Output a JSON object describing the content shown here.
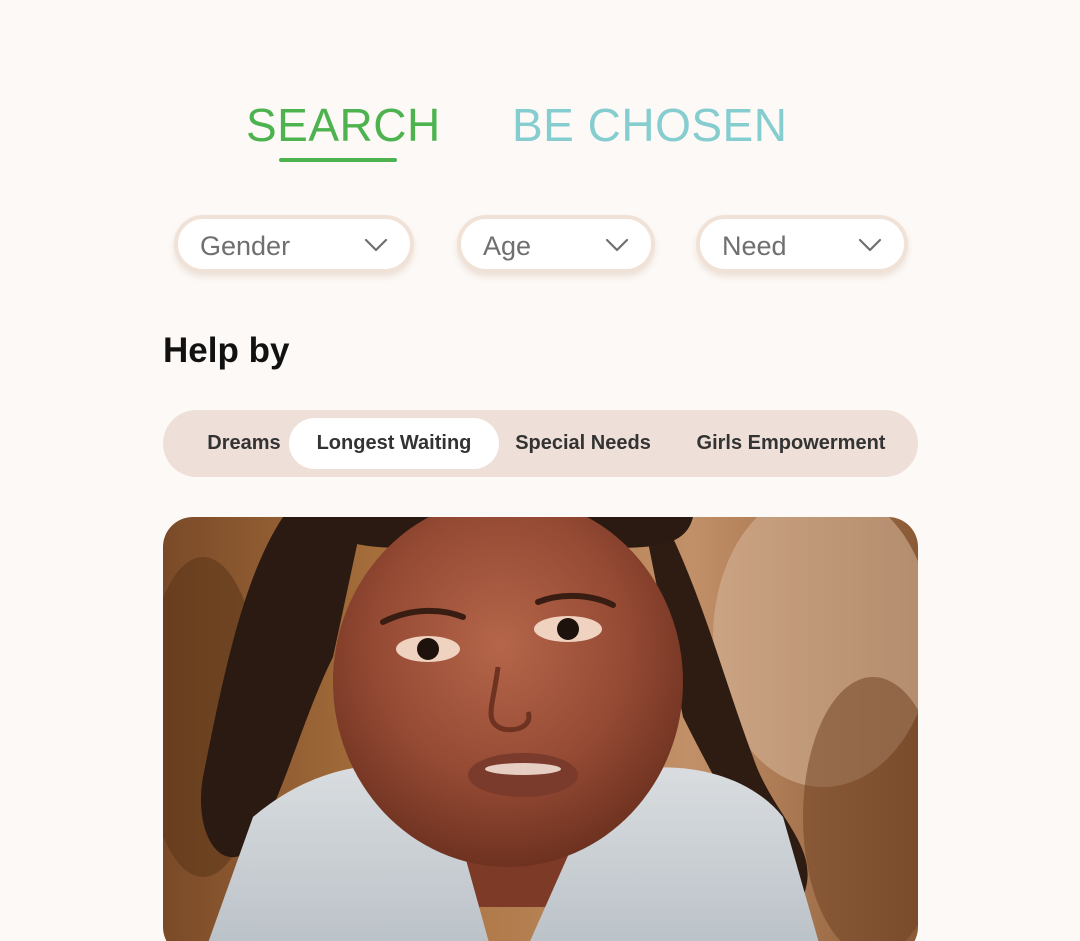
{
  "tabs": {
    "search_label": "SEARCH",
    "chosen_label": "BE CHOSEN",
    "active": "SEARCH"
  },
  "filters": {
    "gender_label": "Gender",
    "age_label": "Age",
    "need_label": "Need",
    "chevron_icon": "chevron-down-icon"
  },
  "help": {
    "title": "Help by",
    "segments": [
      {
        "label": "Dreams"
      },
      {
        "label": "Longest Waiting"
      },
      {
        "label": "Special Needs"
      },
      {
        "label": "Girls Empowerment"
      }
    ],
    "selected": "Longest Waiting"
  },
  "colors": {
    "active_tab": "#4cb34f",
    "inactive_tab": "#86cdd0",
    "background": "#fdf9f6",
    "segment_track": "#eee0d8"
  }
}
